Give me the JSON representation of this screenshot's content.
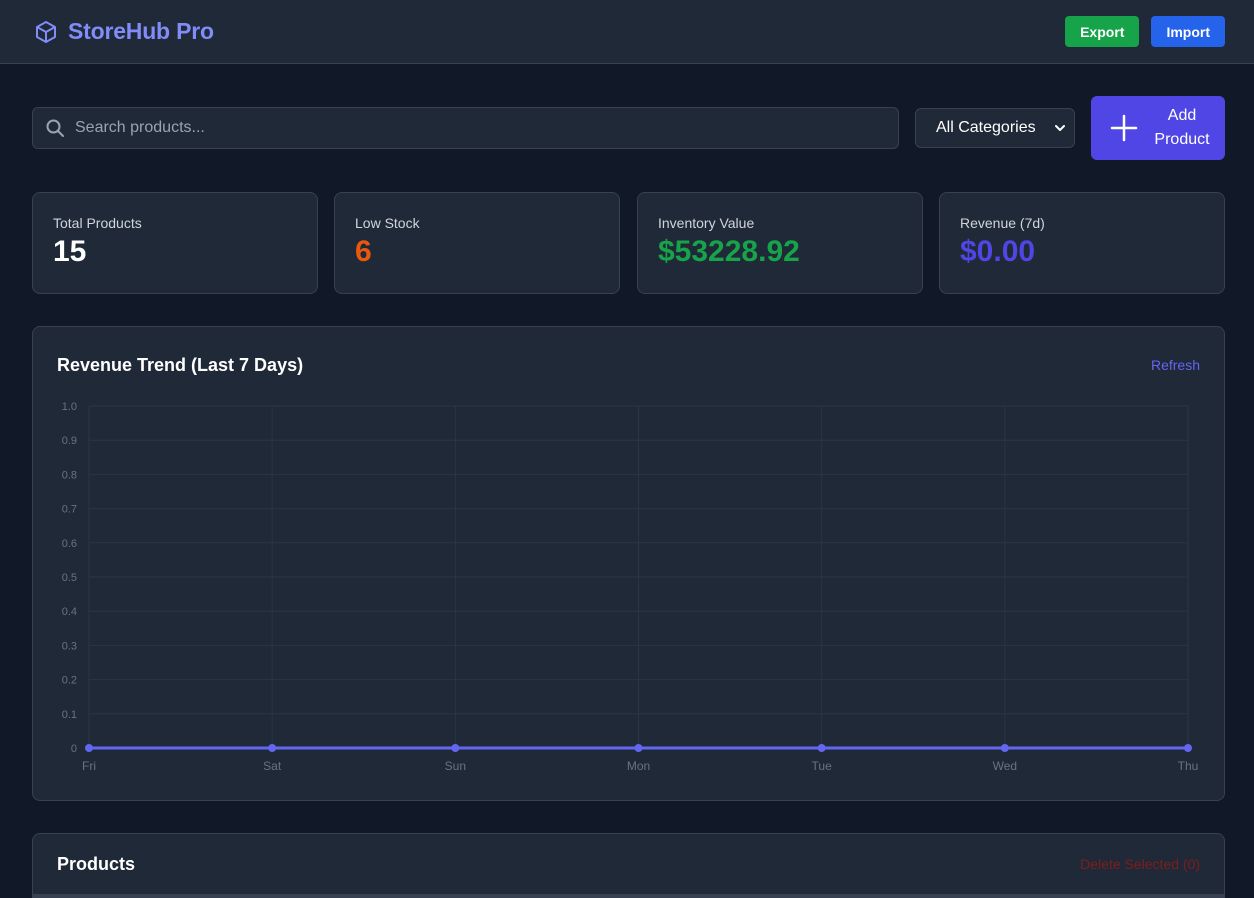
{
  "header": {
    "title": "StoreHub Pro",
    "brand_icon": "cube-icon",
    "export_label": "Export",
    "import_label": "Import",
    "colors": {
      "brand": "#818cf8",
      "export": "#16a34a",
      "import": "#2563eb"
    }
  },
  "toolbar": {
    "search_placeholder": "Search products...",
    "category_selected": "All Categories",
    "add_label": "Add Product",
    "add_color": "#4f46e5"
  },
  "stats": [
    {
      "label": "Total Products",
      "value": "15",
      "color": "#ffffff"
    },
    {
      "label": "Low Stock",
      "value": "6",
      "color": "#ea580c"
    },
    {
      "label": "Inventory Value",
      "value": "$53228.92",
      "color": "#16a34a"
    },
    {
      "label": "Revenue (7d)",
      "value": "$0.00",
      "color": "#4f46e5"
    }
  ],
  "chart": {
    "title": "Revenue Trend (Last 7 Days)",
    "refresh_label": "Refresh"
  },
  "chart_data": {
    "type": "line",
    "title": "Revenue Trend (Last 7 Days)",
    "categories": [
      "Fri",
      "Sat",
      "Sun",
      "Mon",
      "Tue",
      "Wed",
      "Thu"
    ],
    "series": [
      {
        "values": [
          0,
          0,
          0,
          0,
          0,
          0,
          0
        ],
        "color": "#6366f1"
      }
    ],
    "ylim": [
      0,
      1.0
    ],
    "yticks": [
      "0",
      "0.1",
      "0.2",
      "0.3",
      "0.4",
      "0.5",
      "0.6",
      "0.7",
      "0.8",
      "0.9",
      "1.0"
    ],
    "grid": true
  },
  "products": {
    "title": "Products",
    "delete_label": "Delete Selected (0)"
  }
}
